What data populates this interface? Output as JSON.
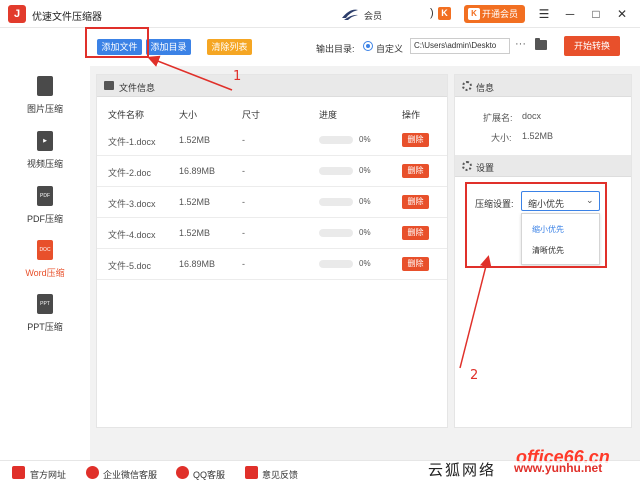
{
  "app": {
    "title": "优速文件压缩器",
    "logo_text": "J",
    "member_text": "会员",
    "paren_text": ")",
    "k_badge": "K",
    "vip_button": "开通会员",
    "minimize": "─",
    "maximize": "□",
    "close": "✕",
    "menu": "☰"
  },
  "sidebar": {
    "items": [
      {
        "label": "图片压缩",
        "icon": "image-file-icon",
        "icon_text": "",
        "active": false
      },
      {
        "label": "视频压缩",
        "icon": "video-file-icon",
        "icon_text": "▶",
        "active": false
      },
      {
        "label": "PDF压缩",
        "icon": "pdf-file-icon",
        "icon_text": "PDF",
        "active": false
      },
      {
        "label": "Word压缩",
        "icon": "word-file-icon",
        "icon_text": "DOC",
        "active": true
      },
      {
        "label": "PPT压缩",
        "icon": "ppt-file-icon",
        "icon_text": "PPT",
        "active": false
      }
    ]
  },
  "toolbar": {
    "add_file": "添加文件",
    "add_dir": "添加目录",
    "clear_list": "清除列表",
    "output_label": "输出目录:",
    "custom_label": "自定义",
    "output_path": "C:\\Users\\admin\\Deskto",
    "more": "···",
    "start": "开始转换"
  },
  "file_panel": {
    "title": "文件信息",
    "columns": [
      "文件名称",
      "大小",
      "尺寸",
      "进度",
      "操作"
    ],
    "rows": [
      {
        "name": "文件-1.docx",
        "size": "1.52MB",
        "dim": "-",
        "progress": "0%",
        "progress_value": 0,
        "action": "删除"
      },
      {
        "name": "文件-2.doc",
        "size": "16.89MB",
        "dim": "-",
        "progress": "0%",
        "progress_value": 0,
        "action": "删除"
      },
      {
        "name": "文件-3.docx",
        "size": "1.52MB",
        "dim": "-",
        "progress": "0%",
        "progress_value": 0,
        "action": "删除"
      },
      {
        "name": "文件-4.docx",
        "size": "1.52MB",
        "dim": "-",
        "progress": "0%",
        "progress_value": 0,
        "action": "删除"
      },
      {
        "name": "文件-5.doc",
        "size": "16.89MB",
        "dim": "-",
        "progress": "0%",
        "progress_value": 0,
        "action": "删除"
      }
    ]
  },
  "info_panel": {
    "title": "信息",
    "ext_label": "扩展名:",
    "ext_value": "docx",
    "size_label": "大小:",
    "size_value": "1.52MB",
    "settings_title": "设置",
    "compress_label": "压缩设置:",
    "compress_value": "缩小优先",
    "options": [
      "缩小优先",
      "清晰优先"
    ]
  },
  "annotations": {
    "one": "1",
    "two": "2"
  },
  "footer": {
    "items": [
      "官方网址",
      "企业微信客服",
      "QQ客服",
      "意见反馈"
    ]
  },
  "watermark": {
    "cn": "云狐网络",
    "office": "office66.cn",
    "url": "www.yunhu.net"
  },
  "colors": {
    "accent_blue": "#3b82e6",
    "accent_orange": "#e8502b",
    "accent_yellow": "#f5a623",
    "annotation_red": "#e0302a"
  }
}
